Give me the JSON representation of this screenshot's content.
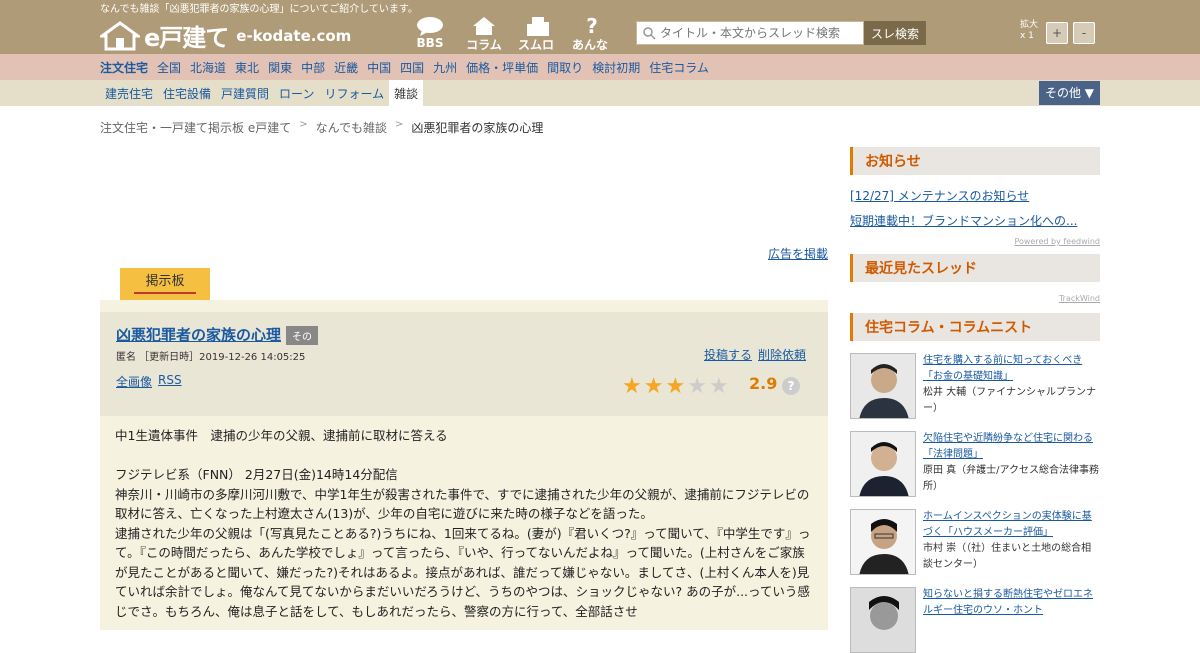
{
  "header": {
    "tagline": "なんでも雑談「凶悪犯罪者の家族の心理」についてご紹介しています。",
    "logo_text": "e戸建て",
    "logo_domain": "e-kodate.com",
    "nav_icons": [
      {
        "label": "BBS",
        "icon": "chat-bubble-icon"
      },
      {
        "label": "コラム",
        "icon": "house-icon"
      },
      {
        "label": "スムログ",
        "icon": "building-icon"
      },
      {
        "label": "あんない",
        "icon": "question-icon"
      }
    ],
    "search_placeholder": "タイトル・本文からスレッド検索",
    "search_button": "スレ検索",
    "zoom_label_1": "拡大",
    "zoom_label_2": "x 1",
    "zoom_plus": "+",
    "zoom_minus": "-"
  },
  "nav1": [
    "注文住宅",
    "全国",
    "北海道",
    "東北",
    "関東",
    "中部",
    "近畿",
    "中国",
    "四国",
    "九州",
    "価格・坪単価",
    "間取り",
    "検討初期",
    "住宅コラム"
  ],
  "nav2": [
    "建売住宅",
    "住宅設備",
    "戸建質問",
    "ローン",
    "リフォーム",
    "雑談"
  ],
  "nav2_active": "雑談",
  "other_button": "その他 ▼",
  "breadcrumb": [
    "注文住宅・一戸建て掲示板 e戸建て",
    "なんでも雑談",
    "凶悪犯罪者の家族の心理"
  ],
  "breadcrumb_sep": ">",
  "ad_link": "広告を掲載",
  "tab_label": "掲示板",
  "thread": {
    "title": "凶悪犯罪者の家族の心理",
    "category": "その",
    "meta": "匿名 ［更新日時］2019-12-26 14:05:25",
    "post_link": "投稿する",
    "delete_link": "削除依頼",
    "full_image_link": "全画像",
    "rss_link": "RSS",
    "rating": "2.9",
    "rating_value": 2.9,
    "stars_filled": 3,
    "stars_total": 5,
    "star_color": "#f5a623",
    "help": "?"
  },
  "body": {
    "line1": "中1生遺体事件　逮捕の少年の父親、逮捕前に取材に答える",
    "line2": "フジテレビ系（FNN） 2月27日(金)14時14分配信",
    "para1": "神奈川・川崎市の多摩川河川敷で、中学1年生が殺害された事件で、すでに逮捕された少年の父親が、逮捕前にフジテレビの取材に答え、亡くなった上村遼太さん(13)が、少年の自宅に遊びに来た時の様子などを語った。",
    "para2": "逮捕された少年の父親は「(写真見たことある?)うちにね、1回来てるね。(妻が)『君いくつ?』って聞いて、『中学生です』って。『この時間だったら、あんた学校でしょ』って言ったら、『いや、行ってないんだよね』って聞いた。(上村さんをご家族が見たことがあると聞いて、嫌だった?)それはあるよ。接点があれば、誰だって嫌じゃない。ましてさ、(上村くん本人を)見ていれば余計でしょ。俺なんて見てないからまだいいだろうけど、うちのやつは、ショックじゃない? あの子が...っていう感じでさ。もちろん、俺は息子と話をして、もしあれだったら、警察の方に行って、全部話させ"
  },
  "sidebar": {
    "news_heading": "お知らせ",
    "news": [
      "[12/27] メンテナンスのお知らせ",
      "短期連載中！ブランドマンション化への..."
    ],
    "news_powered": "Powered by feedwind",
    "recent_heading": "最近見たスレッド",
    "recent_powered": "TrackWind",
    "column_heading": "住宅コラム・コラムニスト",
    "columns": [
      {
        "title": "住宅を購入する前に知っておくべき「お金の基礎知識」",
        "author": "松井 大輔（ファイナンシャルプランナー）"
      },
      {
        "title": "欠陥住宅や近隣紛争など住宅に関わる「法律問題」",
        "author": "原田 真（弁護士/アクセス総合法律事務所）"
      },
      {
        "title": "ホームインスペクションの実体験に基づく「ハウスメーカー評価」",
        "author": "市村 崇（（社）住まいと土地の総合相談センター）"
      },
      {
        "title": "知らないと損する断熱住宅やゼロエネルギー住宅のウソ・ホント",
        "author": ""
      }
    ]
  }
}
